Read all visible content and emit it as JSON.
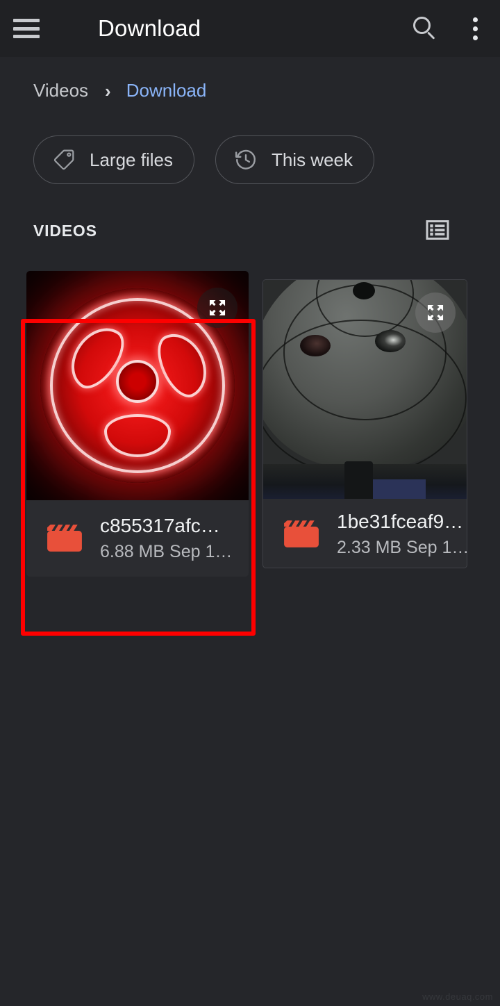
{
  "appbar": {
    "menu_icon": "hamburger-menu-icon",
    "title": "Download",
    "search_icon": "search-icon",
    "overflow_icon": "more-vertical-icon"
  },
  "breadcrumb": {
    "parent": "Videos",
    "separator": "›",
    "current": "Download"
  },
  "chips": [
    {
      "label": "Large files",
      "icon": "tag-icon"
    },
    {
      "label": "This week",
      "icon": "history-icon"
    }
  ],
  "section": {
    "title": "VIDEOS",
    "view_toggle_icon": "list-view-icon"
  },
  "files": [
    {
      "name": "c855317afc…",
      "size": "6.88 MB",
      "date": "Sep 1…",
      "subtitle": "6.88 MB  Sep 1…",
      "type_icon": "movie-clapper-icon",
      "expand_icon": "expand-fullscreen-icon",
      "selected": true
    },
    {
      "name": "1be31fceaf9…",
      "size": "2.33 MB",
      "date": "Sep 1…",
      "subtitle": "2.33 MB  Sep 1…",
      "type_icon": "movie-clapper-icon",
      "expand_icon": "expand-fullscreen-icon",
      "selected": false
    }
  ],
  "annotation": {
    "color": "#fe0000",
    "target": "first-video-card"
  },
  "watermark": "www.deuaq.com",
  "colors": {
    "appbar_bg": "#202124",
    "content_bg": "#25262a",
    "card_bg": "#2b2c30",
    "accent_link": "#8ab4f8",
    "file_icon": "#e8503a",
    "annotation": "#fe0000"
  }
}
